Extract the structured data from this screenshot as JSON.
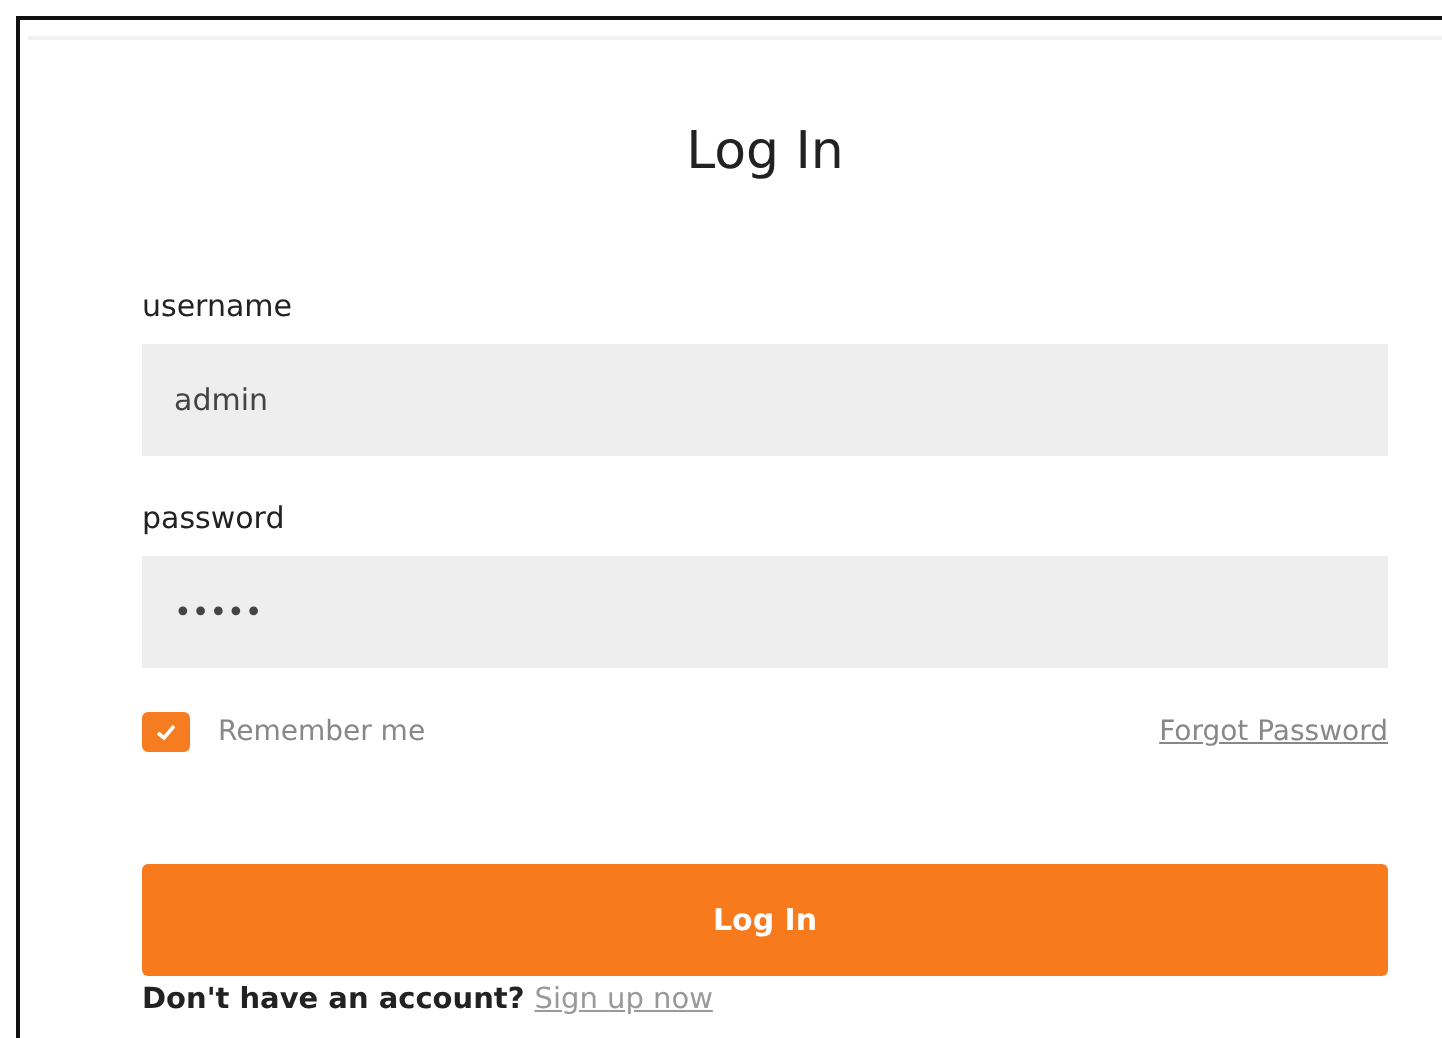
{
  "title": "Log In",
  "fields": [
    {
      "label": "username",
      "value": "admin"
    },
    {
      "label": "password",
      "value": "•••••"
    }
  ],
  "remember": {
    "label": "Remember me",
    "checked": true
  },
  "forgot_link": "Forgot Password",
  "submit_button": "Log In",
  "footer": {
    "text": "Don't have an account?",
    "link": "Sign up now"
  }
}
